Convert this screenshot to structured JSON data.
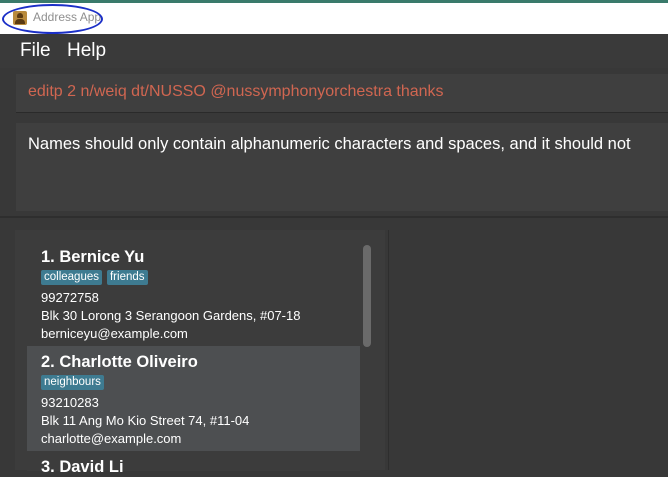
{
  "window": {
    "title": "Address App",
    "icon": "address-book-icon"
  },
  "menu": [
    "File",
    "Help"
  ],
  "command_box": {
    "value": "editp 2 n/weiq dt/NUSSO @nussymphonyorchestra thanks"
  },
  "result_display": {
    "text": "Names should only contain alphanumeric characters and spaces, and it should not"
  },
  "persons": [
    {
      "index_name": "1.  Bernice Yu",
      "tags": [
        "colleagues",
        "friends"
      ],
      "phone": "99272758",
      "address": "Blk 30 Lorong 3 Serangoon Gardens, #07-18",
      "email": "berniceyu@example.com"
    },
    {
      "index_name": "2.  Charlotte Oliveiro",
      "tags": [
        "neighbours"
      ],
      "phone": "93210283",
      "address": "Blk 11 Ang Mo Kio Street 74, #11-04",
      "email": "charlotte@example.com"
    },
    {
      "index_name": "3.  David Li"
    }
  ],
  "colors": {
    "tag_background": "#3e7b91",
    "command_text": "#d06651",
    "annotation_ellipse": "#1b2fc7",
    "selected_card": "#4d4f51"
  }
}
